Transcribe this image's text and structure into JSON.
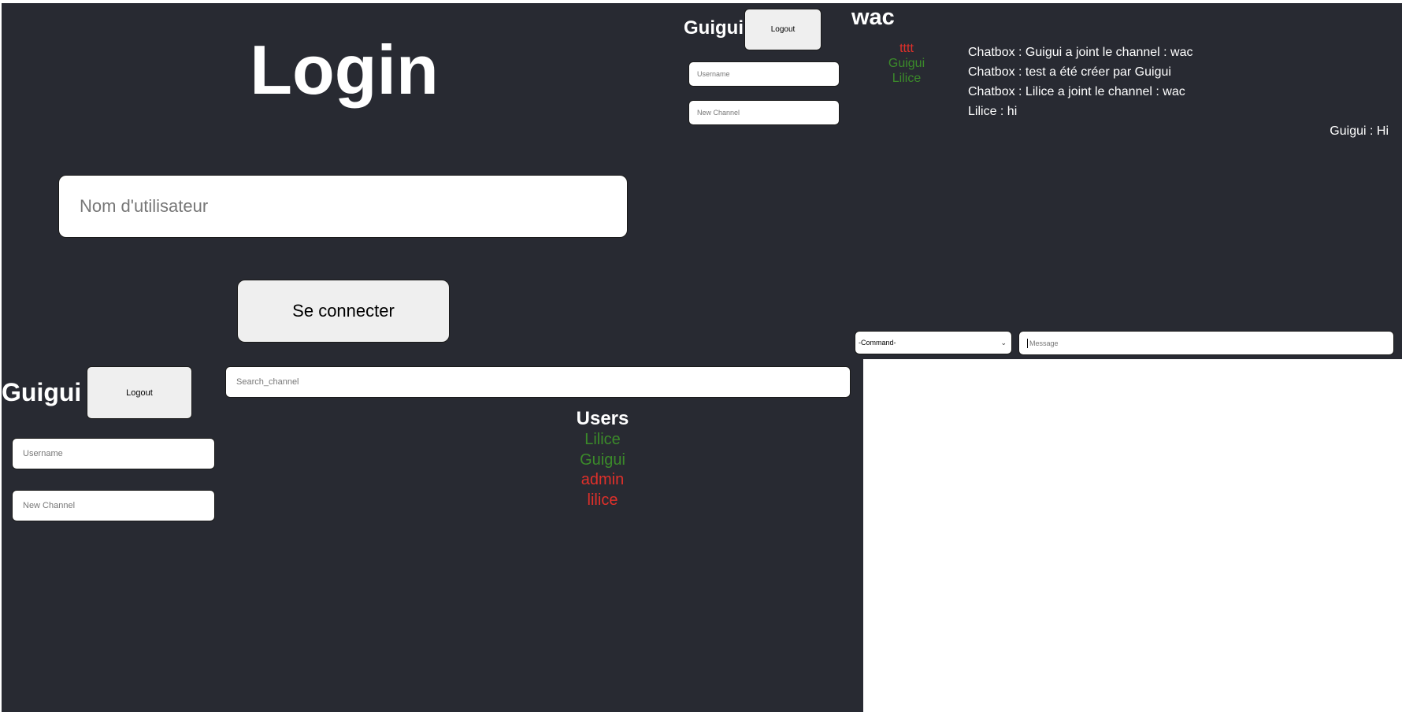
{
  "login": {
    "title": "Login",
    "username_placeholder": "Nom d'utilisateur",
    "submit_label": "Se connecter"
  },
  "chat": {
    "user_name": "Guigui",
    "logout_label": "Logout",
    "username_placeholder": "Username",
    "new_channel_placeholder": "New Channel",
    "channel_title": "wac",
    "channel_users": [
      {
        "name": "tttt",
        "status": "offline",
        "color": "#e0302a"
      },
      {
        "name": "Guigui",
        "status": "online",
        "color": "#3b8a2a"
      },
      {
        "name": "Lilice",
        "status": "online",
        "color": "#3b8a2a"
      }
    ],
    "messages": [
      {
        "text": "Chatbox : Guigui a joint le channel : wac",
        "align": "left"
      },
      {
        "text": "Chatbox : test a été créer par Guigui",
        "align": "left"
      },
      {
        "text": "Chatbox : Lilice a joint le channel : wac",
        "align": "left"
      },
      {
        "text": "Lilice : hi",
        "align": "left"
      },
      {
        "text": "Guigui : Hi",
        "align": "right"
      }
    ],
    "command_select": "-Command-",
    "message_placeholder": "Message"
  },
  "home": {
    "user_name": "Guigui",
    "logout_label": "Logout",
    "username_placeholder": "Username",
    "new_channel_placeholder": "New Channel",
    "search_placeholder": "Search_channel",
    "users_title": "Users",
    "users": [
      {
        "name": "Lilice",
        "status": "online",
        "color": "#3b8a2a"
      },
      {
        "name": "Guigui",
        "status": "online",
        "color": "#3b8a2a"
      },
      {
        "name": "admin",
        "status": "offline",
        "color": "#e0302a"
      },
      {
        "name": "lilice",
        "status": "offline",
        "color": "#e0302a"
      }
    ]
  }
}
